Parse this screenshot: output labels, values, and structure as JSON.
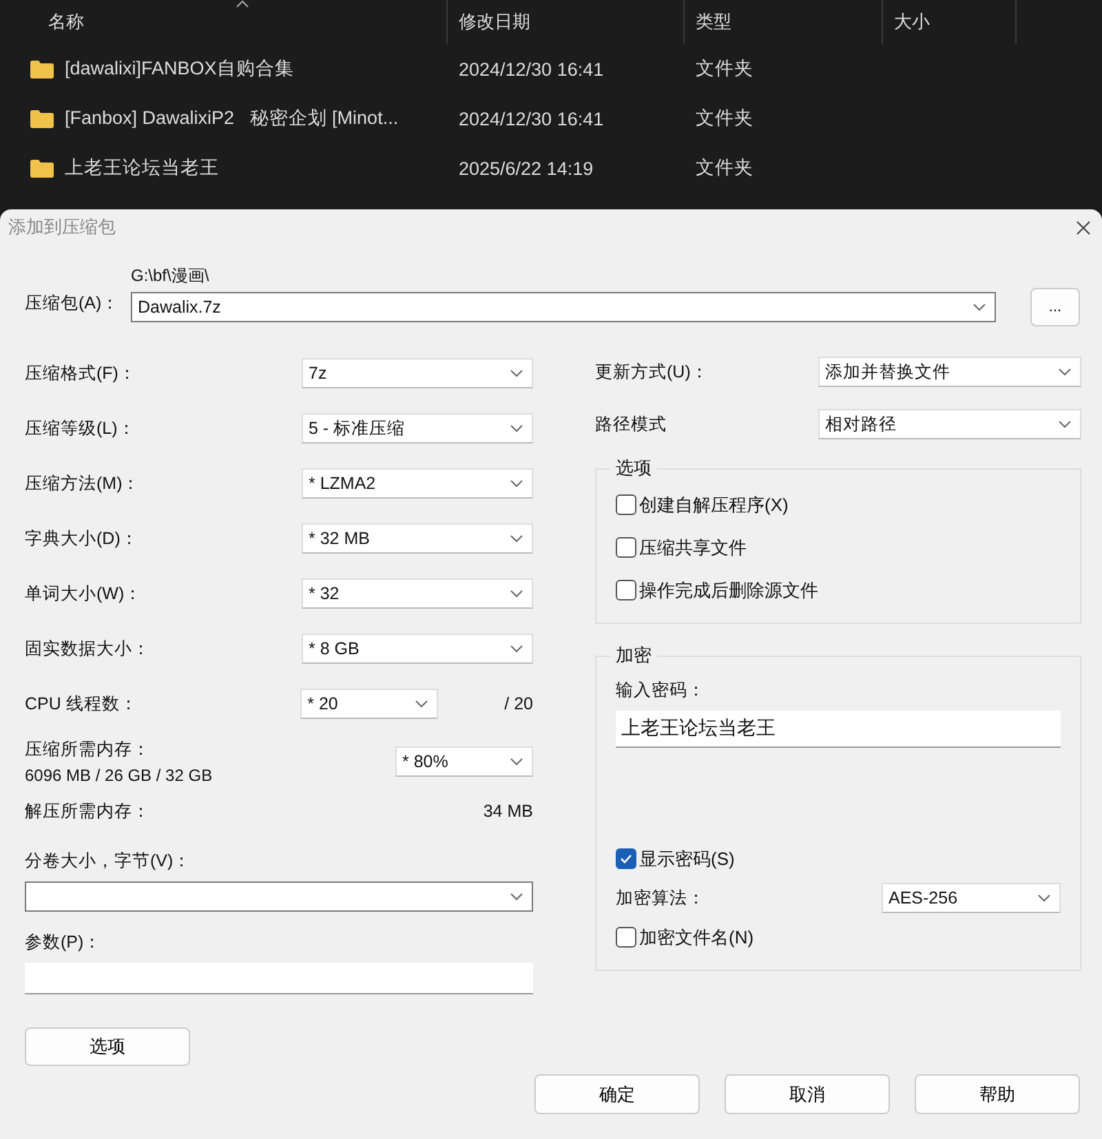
{
  "explorer": {
    "columns": [
      "名称",
      "修改日期",
      "类型",
      "大小"
    ],
    "rows": [
      {
        "name": "[dawalixi]FANBOX自购合集",
        "date": "2024/12/30 16:41",
        "type": "文件夹"
      },
      {
        "name": "[Fanbox] DawalixiP2   秘密企划 [Minot...",
        "date": "2024/12/30 16:41",
        "type": "文件夹"
      },
      {
        "name": "上老王论坛当老王",
        "date": "2025/6/22 14:19",
        "type": "文件夹"
      }
    ]
  },
  "dialog": {
    "title": "添加到压缩包",
    "archive": {
      "label": "压缩包(A)：",
      "path": "G:\\bf\\漫画\\",
      "value": "Dawalix.7z",
      "browse": "..."
    },
    "left_fields": [
      {
        "label": "压缩格式(F)：",
        "value": "7z"
      },
      {
        "label": "压缩等级(L)：",
        "value": "5 - 标准压缩"
      },
      {
        "label": "压缩方法(M)：",
        "value": "* LZMA2"
      },
      {
        "label": "字典大小(D)：",
        "value": "* 32 MB"
      },
      {
        "label": "单词大小(W)：",
        "value": "* 32"
      },
      {
        "label": "固实数据大小：",
        "value": "* 8 GB"
      }
    ],
    "cpu": {
      "label": "CPU 线程数：",
      "value": "* 20",
      "max": "/ 20"
    },
    "memory": {
      "label": "压缩所需内存：",
      "detail": "6096 MB / 26 GB / 32 GB",
      "value": "* 80%"
    },
    "decompress": {
      "label": "解压所需内存：",
      "value": "34 MB"
    },
    "volume": {
      "label": "分卷大小，字节(V)："
    },
    "params": {
      "label": "参数(P)："
    },
    "options_button": "选项",
    "right_fields": [
      {
        "label": "更新方式(U)：",
        "value": "添加并替换文件"
      },
      {
        "label": "路径模式",
        "value": "相对路径"
      }
    ],
    "options": {
      "title": "选项",
      "checks": [
        {
          "label": "创建自解压程序(X)",
          "checked": false
        },
        {
          "label": "压缩共享文件",
          "checked": false
        },
        {
          "label": "操作完成后删除源文件",
          "checked": false
        }
      ]
    },
    "encryption": {
      "title": "加密",
      "password_label": "输入密码：",
      "password": "上老王论坛当老王",
      "show_password": {
        "label": "显示密码(S)",
        "checked": true
      },
      "algorithm": {
        "label": "加密算法：",
        "value": "AES-256"
      },
      "encrypt_names": {
        "label": "加密文件名(N)",
        "checked": false
      }
    },
    "buttons": [
      "确定",
      "取消",
      "帮助"
    ]
  }
}
